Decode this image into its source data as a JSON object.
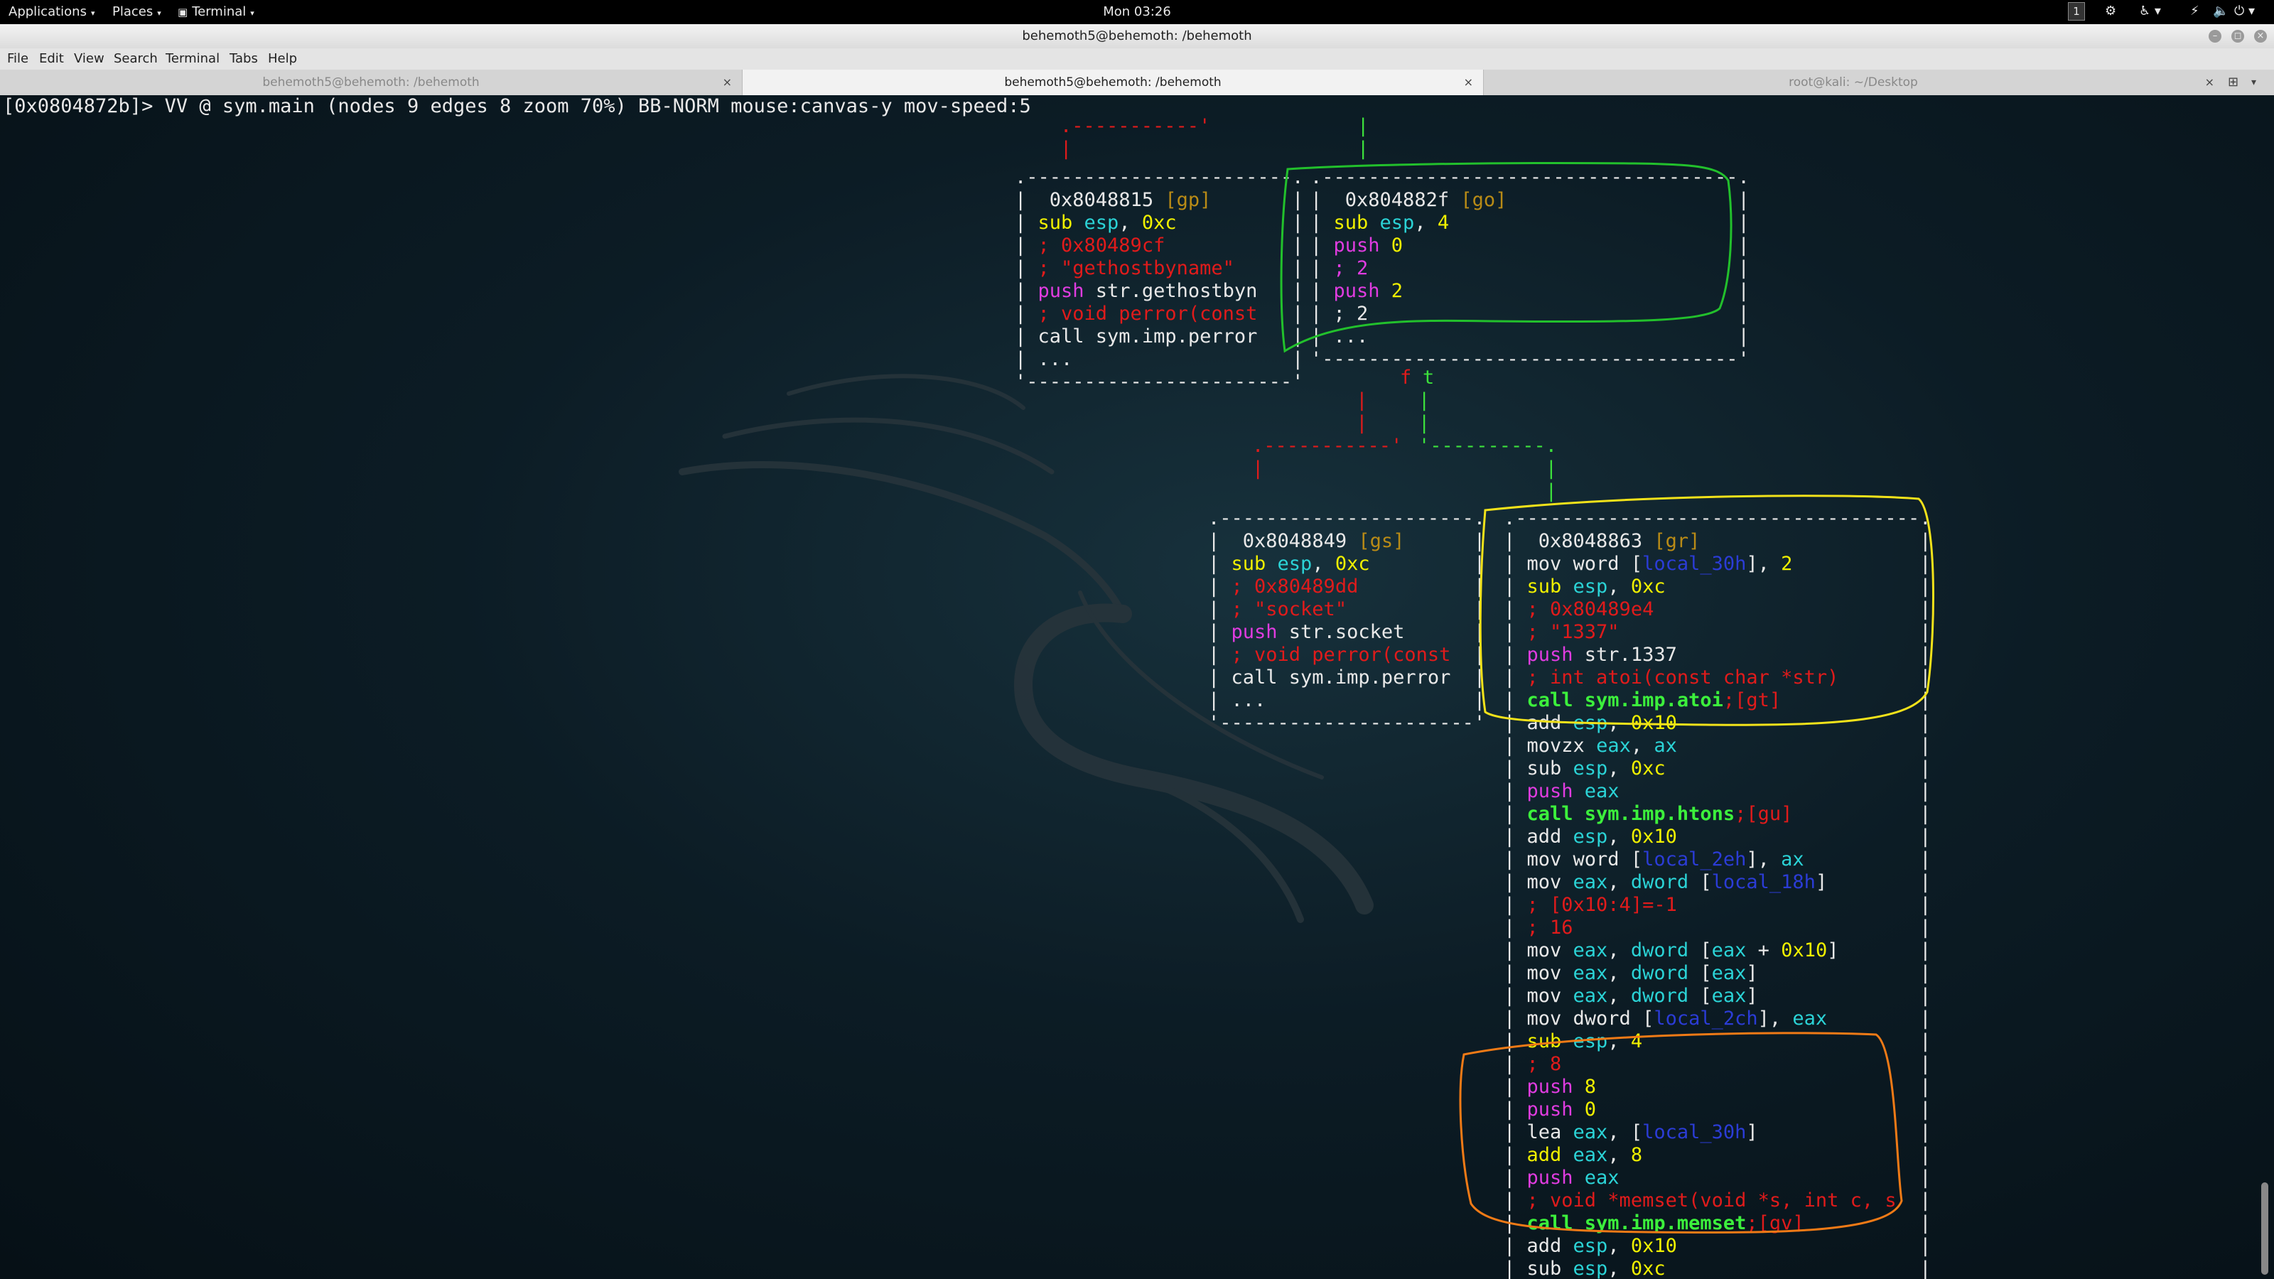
{
  "panel": {
    "applications": "Applications",
    "places": "Places",
    "terminal": "Terminal",
    "clock": "Mon 03:26",
    "workspace": "1"
  },
  "window": {
    "title": "behemoth5@behemoth: /behemoth"
  },
  "menubar": [
    "File",
    "Edit",
    "View",
    "Search",
    "Terminal",
    "Tabs",
    "Help"
  ],
  "tabs": [
    {
      "label": "behemoth5@behemoth: /behemoth",
      "active": false
    },
    {
      "label": "behemoth5@behemoth: /behemoth",
      "active": true
    },
    {
      "label": "root@kali: ~/Desktop",
      "active": false
    }
  ],
  "terminal": {
    "prompt": "[0x0804872b]> VV @ sym.main (nodes 9 edges 8 zoom 70%) BB-NORM mouse:canvas-y mov-speed:5"
  },
  "nodes": {
    "gp": {
      "addr": "0x8048815",
      "label": "[gp]",
      "lines": [
        [
          [
            "sub ",
            "mn"
          ],
          [
            "esp",
            "reg"
          ],
          [
            ", ",
            "w"
          ],
          [
            "0xc",
            "imm"
          ]
        ],
        [
          [
            "; 0x80489cf",
            "cmt"
          ]
        ],
        [
          [
            "; \"gethostbyname\"",
            "cmt"
          ]
        ],
        [
          [
            "push ",
            "push"
          ],
          [
            "str.gethostbyn",
            "w"
          ]
        ],
        [
          [
            "; void perror(const",
            "cmt"
          ]
        ],
        [
          [
            "call sym.imp.perror",
            "w"
          ]
        ],
        [
          [
            "...",
            "w"
          ]
        ]
      ]
    },
    "go": {
      "addr": "0x804882f",
      "label": "[go]",
      "lines": [
        [
          [
            "sub ",
            "mn"
          ],
          [
            "esp",
            "reg"
          ],
          [
            ", ",
            "w"
          ],
          [
            "4",
            "imm"
          ]
        ],
        [
          [
            "push ",
            "push"
          ],
          [
            "0",
            "imm"
          ]
        ],
        [
          [
            "; 2",
            "push"
          ]
        ],
        [
          [
            "push ",
            "push"
          ],
          [
            "2",
            "imm"
          ]
        ],
        [
          [
            "; 2",
            "w"
          ]
        ],
        [
          [
            "...",
            "w"
          ]
        ]
      ]
    },
    "gs": {
      "addr": "0x8048849",
      "label": "[gs]",
      "lines": [
        [
          [
            "sub ",
            "mn"
          ],
          [
            "esp",
            "reg"
          ],
          [
            ", ",
            "w"
          ],
          [
            "0xc",
            "imm"
          ]
        ],
        [
          [
            "; 0x80489dd",
            "cmt"
          ]
        ],
        [
          [
            "; \"socket\"",
            "cmt"
          ]
        ],
        [
          [
            "push ",
            "push"
          ],
          [
            "str.socket",
            "w"
          ]
        ],
        [
          [
            "; void perror(const",
            "cmt"
          ]
        ],
        [
          [
            "call sym.imp.perror",
            "w"
          ]
        ],
        [
          [
            "...",
            "w"
          ]
        ]
      ]
    },
    "gr": {
      "addr": "0x8048863",
      "label": "[gr]",
      "lines": [
        [
          [
            "mov word [",
            "w"
          ],
          [
            "local_30h",
            "loc"
          ],
          [
            "], ",
            "w"
          ],
          [
            "2",
            "imm"
          ]
        ],
        [
          [
            "sub ",
            "mn"
          ],
          [
            "esp",
            "reg"
          ],
          [
            ", ",
            "w"
          ],
          [
            "0xc",
            "imm"
          ]
        ],
        [
          [
            "; 0x80489e4",
            "cmt"
          ]
        ],
        [
          [
            "; \"1337\"",
            "cmt"
          ]
        ],
        [
          [
            "push ",
            "push"
          ],
          [
            "str.1337",
            "w"
          ]
        ],
        [
          [
            "; int atoi(const char *str)",
            "cmt"
          ]
        ],
        [
          [
            "call sym.imp.atoi",
            "call"
          ],
          [
            ";[gt]",
            "cmt"
          ]
        ],
        [
          [
            "add ",
            "w"
          ],
          [
            "esp",
            "reg"
          ],
          [
            ", ",
            "w"
          ],
          [
            "0x10",
            "imm"
          ]
        ],
        [
          [
            "movzx ",
            "w"
          ],
          [
            "eax",
            "reg"
          ],
          [
            ", ",
            "w"
          ],
          [
            "ax",
            "reg"
          ]
        ],
        [
          [
            "sub ",
            "w"
          ],
          [
            "esp",
            "reg"
          ],
          [
            ", ",
            "w"
          ],
          [
            "0xc",
            "imm"
          ]
        ],
        [
          [
            "push ",
            "push"
          ],
          [
            "eax",
            "reg"
          ]
        ],
        [
          [
            "call sym.imp.htons",
            "call"
          ],
          [
            ";[gu]",
            "cmt"
          ]
        ],
        [
          [
            "add ",
            "w"
          ],
          [
            "esp",
            "reg"
          ],
          [
            ", ",
            "w"
          ],
          [
            "0x10",
            "imm"
          ]
        ],
        [
          [
            "mov word [",
            "w"
          ],
          [
            "local_2eh",
            "loc"
          ],
          [
            "], ",
            "w"
          ],
          [
            "ax",
            "reg"
          ]
        ],
        [
          [
            "mov ",
            "w"
          ],
          [
            "eax",
            "reg"
          ],
          [
            ", ",
            "w"
          ],
          [
            "dword",
            "reg"
          ],
          [
            " [",
            "w"
          ],
          [
            "local_18h",
            "loc"
          ],
          [
            "]",
            "w"
          ]
        ],
        [
          [
            "; [0x10:4]=-1",
            "cmt"
          ]
        ],
        [
          [
            "; 16",
            "cmt"
          ]
        ],
        [
          [
            "mov ",
            "w"
          ],
          [
            "eax",
            "reg"
          ],
          [
            ", ",
            "w"
          ],
          [
            "dword",
            "reg"
          ],
          [
            " [",
            "w"
          ],
          [
            "eax",
            "reg"
          ],
          [
            " + ",
            "w"
          ],
          [
            "0x10",
            "imm"
          ],
          [
            "]",
            "w"
          ]
        ],
        [
          [
            "mov ",
            "w"
          ],
          [
            "eax",
            "reg"
          ],
          [
            ", ",
            "w"
          ],
          [
            "dword",
            "reg"
          ],
          [
            " [",
            "w"
          ],
          [
            "eax",
            "reg"
          ],
          [
            "]",
            "w"
          ]
        ],
        [
          [
            "mov ",
            "w"
          ],
          [
            "eax",
            "reg"
          ],
          [
            ", ",
            "w"
          ],
          [
            "dword",
            "reg"
          ],
          [
            " [",
            "w"
          ],
          [
            "eax",
            "reg"
          ],
          [
            "]",
            "w"
          ]
        ],
        [
          [
            "mov dword [",
            "w"
          ],
          [
            "local_2ch",
            "loc"
          ],
          [
            "], ",
            "w"
          ],
          [
            "eax",
            "reg"
          ]
        ],
        [
          [
            "sub ",
            "mn"
          ],
          [
            "esp",
            "reg"
          ],
          [
            ", ",
            "w"
          ],
          [
            "4",
            "imm"
          ]
        ],
        [
          [
            "; 8",
            "cmt"
          ]
        ],
        [
          [
            "push ",
            "push"
          ],
          [
            "8",
            "imm"
          ]
        ],
        [
          [
            "push ",
            "push"
          ],
          [
            "0",
            "imm"
          ]
        ],
        [
          [
            "lea ",
            "w"
          ],
          [
            "eax",
            "reg"
          ],
          [
            ", [",
            "w"
          ],
          [
            "local_30h",
            "loc"
          ],
          [
            "]",
            "w"
          ]
        ],
        [
          [
            "add ",
            "mn"
          ],
          [
            "eax",
            "reg"
          ],
          [
            ", ",
            "w"
          ],
          [
            "8",
            "imm"
          ]
        ],
        [
          [
            "push ",
            "push"
          ],
          [
            "eax",
            "reg"
          ]
        ],
        [
          [
            "; void *memset(void *s, int c, s",
            "cmt"
          ]
        ],
        [
          [
            "call sym.imp.memset",
            "call"
          ],
          [
            ";[gv]",
            "cmt"
          ]
        ],
        [
          [
            "add ",
            "w"
          ],
          [
            "esp",
            "reg"
          ],
          [
            ", ",
            "w"
          ],
          [
            "0x10",
            "imm"
          ]
        ],
        [
          [
            "sub ",
            "w"
          ],
          [
            "esp",
            "reg"
          ],
          [
            ", ",
            "w"
          ],
          [
            "0xc",
            "imm"
          ]
        ]
      ]
    }
  },
  "edges": {
    "f": "f",
    "t": "t"
  },
  "colors": {
    "terminal_bg": "#0b1a22",
    "annotation_green": "#22c02c",
    "annotation_yellow": "#f2e21a",
    "annotation_orange": "#f07a16",
    "comment_red": "#e01b1b",
    "immediate_yellow": "#f0f000",
    "register_cyan": "#2bd3d6",
    "push_magenta": "#e03ce0",
    "call_green": "#3cf03c",
    "label_gold": "#b98b16",
    "local_blue": "#2b3cd6"
  },
  "icons": [
    "terminal-icon",
    "workspace-indicator",
    "network-icon",
    "accessibility-icon",
    "volume-icon",
    "power-icon",
    "minimize-icon",
    "maximize-icon",
    "close-icon",
    "new-tab-icon"
  ]
}
